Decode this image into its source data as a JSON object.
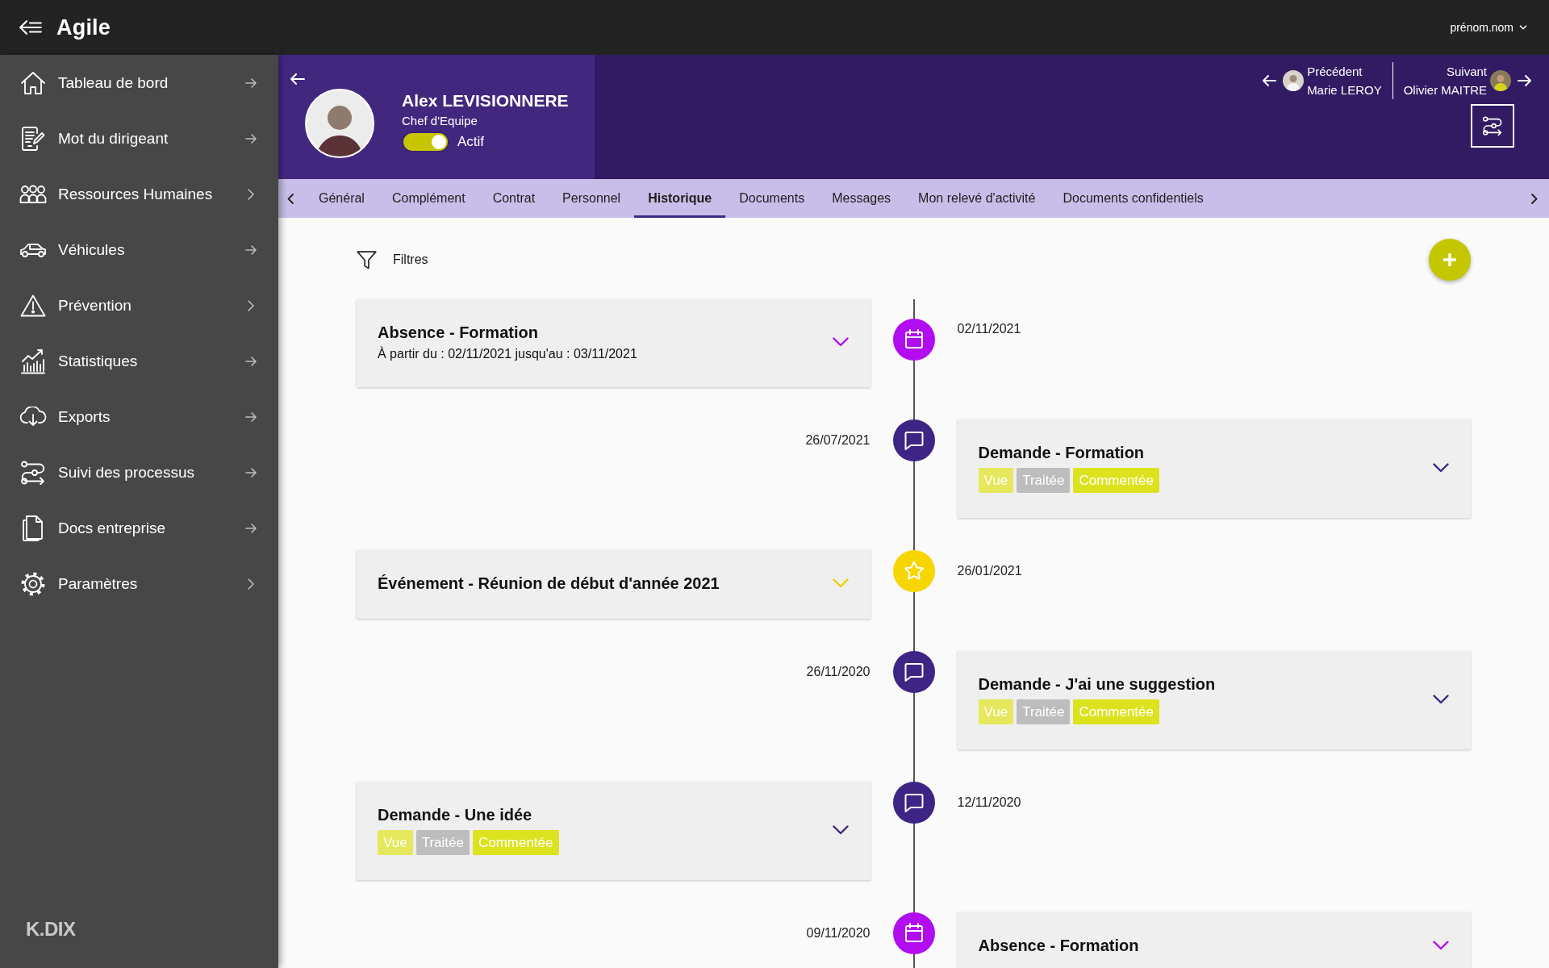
{
  "topbar": {
    "logo": "Agile",
    "user": "prénom.nom"
  },
  "sidebar": {
    "items": [
      {
        "label": "Tableau de bord",
        "kind": "link"
      },
      {
        "label": "Mot du dirigeant",
        "kind": "link"
      },
      {
        "label": "Ressources Humaines",
        "kind": "submenu"
      },
      {
        "label": "Véhicules",
        "kind": "link"
      },
      {
        "label": "Prévention",
        "kind": "submenu"
      },
      {
        "label": "Statistiques",
        "kind": "link"
      },
      {
        "label": "Exports",
        "kind": "link"
      },
      {
        "label": "Suivi des processus",
        "kind": "link"
      },
      {
        "label": "Docs entreprise",
        "kind": "link"
      },
      {
        "label": "Paramètres",
        "kind": "submenu"
      }
    ],
    "footer_logo": "K.DIX"
  },
  "profile": {
    "name": "Alex LEVISIONNERE",
    "role": "Chef d'Equipe",
    "status": {
      "label": "Actif",
      "on": true
    },
    "previous": {
      "label": "Précédent",
      "name": "Marie LEROY"
    },
    "next": {
      "label": "Suivant",
      "name": "Olivier MAITRE"
    }
  },
  "tabs": [
    {
      "label": "Général",
      "selected": false
    },
    {
      "label": "Complément",
      "selected": false
    },
    {
      "label": "Contrat",
      "selected": false
    },
    {
      "label": "Personnel",
      "selected": false
    },
    {
      "label": "Historique",
      "selected": true
    },
    {
      "label": "Documents",
      "selected": false
    },
    {
      "label": "Messages",
      "selected": false
    },
    {
      "label": "Mon relevé d'activité",
      "selected": false
    },
    {
      "label": "Documents confidentiels",
      "selected": false
    }
  ],
  "filters": {
    "label": "Filtres"
  },
  "timeline": [
    {
      "kind": "absence",
      "date": "02/11/2021",
      "title": "Absence - Formation",
      "detail": "À partir du : 02/11/2021 jusqu'au : 03/11/2021"
    },
    {
      "kind": "demande",
      "date": "26/07/2021",
      "title": "Demande - Formation",
      "tags": [
        {
          "label": "Vue",
          "color": "#e5e85c"
        },
        {
          "label": "Traitée",
          "color": "#bdbdbd"
        },
        {
          "label": "Commentée",
          "color": "#dde21f"
        }
      ]
    },
    {
      "kind": "evenement",
      "date": "26/01/2021",
      "title": "Événement - Réunion de début d'année 2021"
    },
    {
      "kind": "demande",
      "date": "26/11/2020",
      "title": "Demande - J'ai une suggestion",
      "tags": [
        {
          "label": "Vue",
          "color": "#e5e85c"
        },
        {
          "label": "Traitée",
          "color": "#bdbdbd"
        },
        {
          "label": "Commentée",
          "color": "#dde21f"
        }
      ]
    },
    {
      "kind": "demande",
      "date": "12/11/2020",
      "title": "Demande - Une idée",
      "tags": [
        {
          "label": "Vue",
          "color": "#e5e85c"
        },
        {
          "label": "Traitée",
          "color": "#bdbdbd"
        },
        {
          "label": "Commentée",
          "color": "#dde21f"
        }
      ]
    },
    {
      "kind": "absence",
      "date": "09/11/2020",
      "title": "Absence - Formation"
    }
  ]
}
